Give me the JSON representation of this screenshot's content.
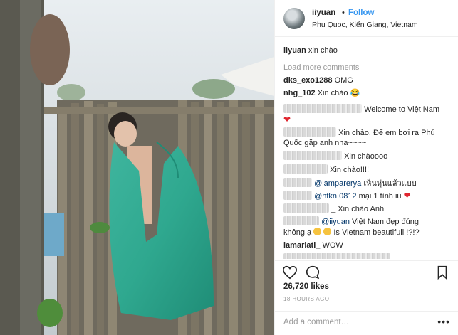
{
  "post": {
    "username": "iiyuan",
    "separator": "•",
    "follow_label": "Follow",
    "location": "Phu Quoc, Kiến Giang, Vietnam"
  },
  "comments": {
    "caption": {
      "user": "iiyuan",
      "text": "xin chào"
    },
    "load_more": "Load more comments",
    "items": [
      {
        "user": "dks_exo1288",
        "text": "OMG"
      },
      {
        "user": "nhg_102",
        "text": "Xin chào 😂"
      },
      {
        "text": "Welcome to Việt Nam"
      },
      {
        "text": "Xin chào. Để em bơi ra Phú"
      },
      {
        "text": "Quốc gặp anh nha~~~~"
      },
      {
        "text": "Xin chàoooo"
      },
      {
        "text": "Xin chào!!!!"
      },
      {
        "mention": "@iamparerya",
        "text": "เห็นหุ่นแล้วแบบ"
      },
      {
        "mention": "@ntkn.0812",
        "text": "mại 1 tình iu"
      },
      {
        "text": "_ Xin chào Anh"
      },
      {
        "mention": "@iiyuan",
        "text": "Việt Nam đẹp đúng"
      },
      {
        "text": "không ạ",
        "text2": "Is Vietnam beautifull !?!?"
      },
      {
        "user": "lamariati_",
        "text": "WOW"
      }
    ]
  },
  "icons": {
    "like": "heart-icon",
    "comment": "comment-icon",
    "save": "bookmark-icon",
    "more": "more-options-icon"
  },
  "likes": "26,720 likes",
  "timestamp": "18 HOURS AGO",
  "add_comment_placeholder": "Add a comment…",
  "more_label": "•••"
}
